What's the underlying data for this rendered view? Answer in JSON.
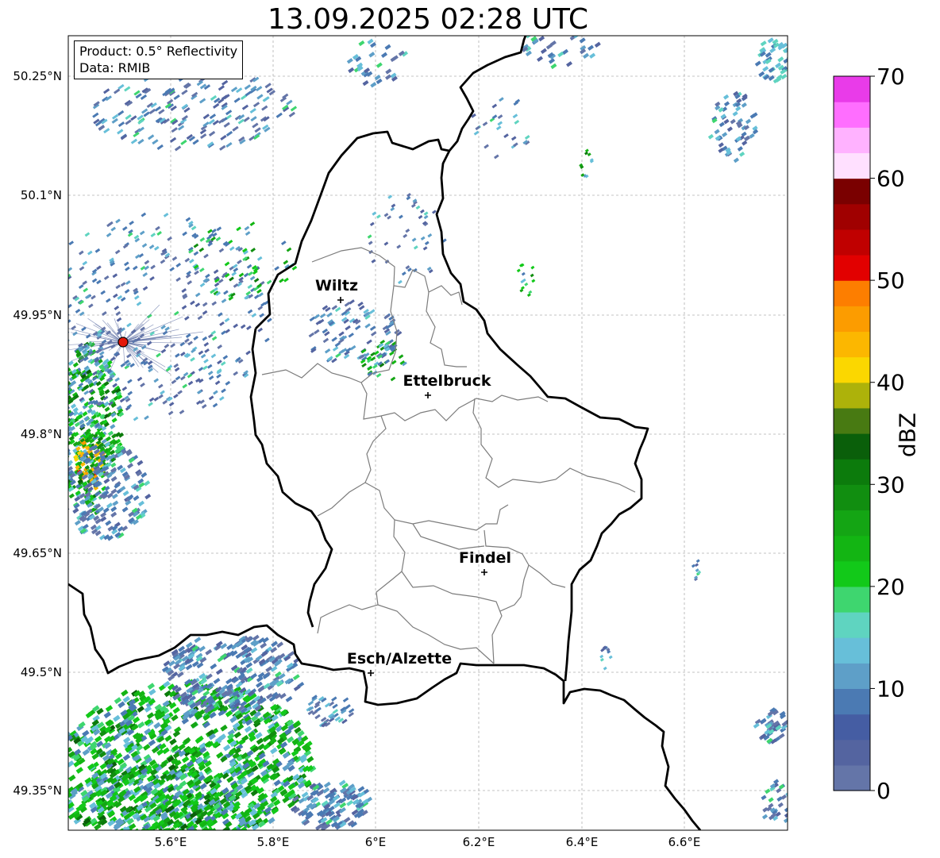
{
  "title": "13.09.2025 02:28 UTC",
  "info": {
    "product": "Product: 0.5° Reflectivity",
    "data_source": "Data: RMIB"
  },
  "lat_labels": [
    "50.25°N",
    "50.1°N",
    "49.95°N",
    "49.8°N",
    "49.65°N",
    "49.5°N",
    "49.35°N"
  ],
  "lon_labels": [
    "5.6°E",
    "5.8°E",
    "6°E",
    "6.2°E",
    "6.4°E",
    "6.6°E"
  ],
  "cities": [
    {
      "name": "Wiltz"
    },
    {
      "name": "Ettelbruck"
    },
    {
      "name": "Findel"
    },
    {
      "name": "Esch/Alzette"
    }
  ],
  "radar_site": {
    "marker_color": "#e3170a"
  },
  "colorbar": {
    "label": "dBZ",
    "ticks": [
      "0",
      "10",
      "20",
      "30",
      "40",
      "50",
      "60",
      "70"
    ],
    "colors": [
      "#6475a8",
      "#5464a0",
      "#455da3",
      "#4b7ab3",
      "#5e9fc8",
      "#67bfd9",
      "#5fd4c0",
      "#3ed66f",
      "#12c919",
      "#13b513",
      "#14a514",
      "#118e10",
      "#0c7b0c",
      "#0a5f0a",
      "#487a12",
      "#adb20a",
      "#fbd700",
      "#fcb700",
      "#fc9c00",
      "#fd7e00",
      "#e20000",
      "#c00000",
      "#a00000",
      "#7a0000",
      "#ffe0ff",
      "#ffb2ff",
      "#ff6eff",
      "#e93be9"
    ]
  }
}
